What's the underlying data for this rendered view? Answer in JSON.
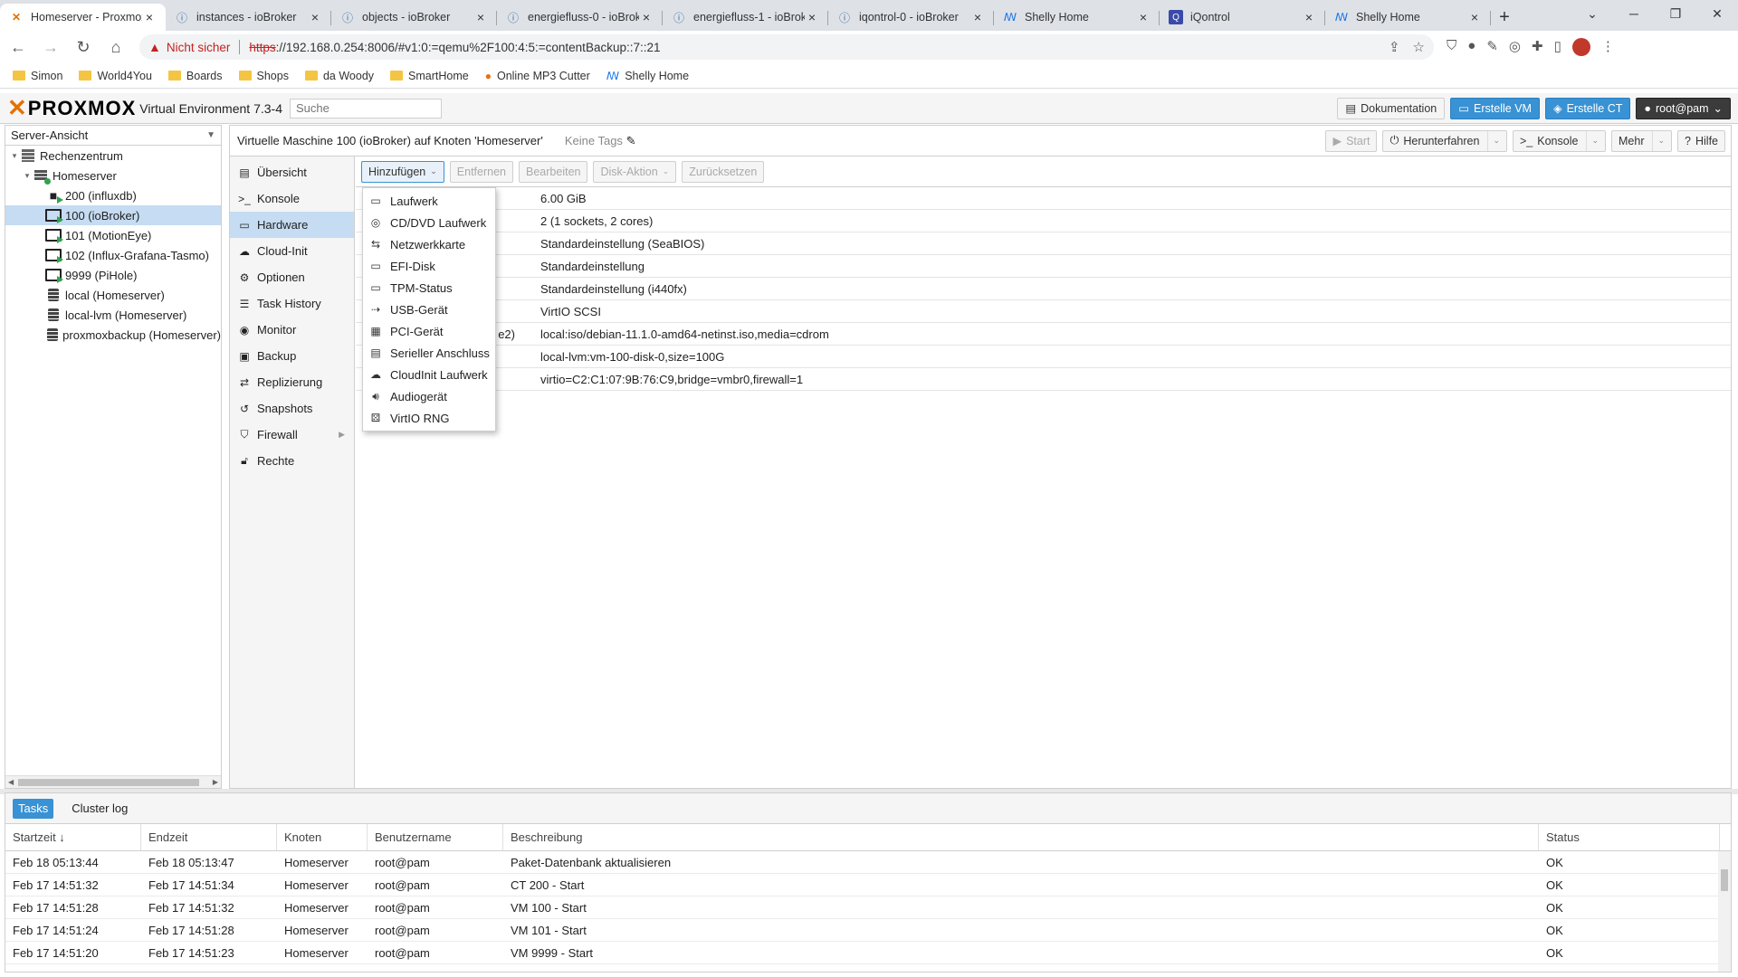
{
  "browser": {
    "tabs": [
      {
        "title": "Homeserver - Proxmox",
        "active": true,
        "icon": "proxmox-icon"
      },
      {
        "title": "instances - ioBroker",
        "icon": "iobroker-icon"
      },
      {
        "title": "objects - ioBroker",
        "icon": "iobroker-icon"
      },
      {
        "title": "energiefluss-0 - ioBroker",
        "icon": "iobroker-icon"
      },
      {
        "title": "energiefluss-1 - ioBroker",
        "icon": "iobroker-icon"
      },
      {
        "title": "iqontrol-0 - ioBroker",
        "icon": "iobroker-icon"
      },
      {
        "title": "Shelly Home",
        "icon": "shelly-icon"
      },
      {
        "title": "iQontrol",
        "icon": "iqontrol-icon"
      },
      {
        "title": "Shelly Home",
        "icon": "shelly-icon"
      }
    ],
    "address": {
      "security_label": "Nicht sicher",
      "scheme": "https",
      "rest": "://192.168.0.254:8006/#v1:0:=qemu%2F100:4:5:=contentBackup::7::21"
    },
    "bookmarks": [
      {
        "label": "Simon",
        "type": "folder"
      },
      {
        "label": "World4You",
        "type": "folder"
      },
      {
        "label": "Boards",
        "type": "folder"
      },
      {
        "label": "Shops",
        "type": "folder"
      },
      {
        "label": "da Woody",
        "type": "folder"
      },
      {
        "label": "SmartHome",
        "type": "folder"
      },
      {
        "label": "Online MP3 Cutter",
        "type": "link"
      },
      {
        "label": "Shelly Home",
        "type": "link"
      }
    ]
  },
  "header": {
    "logo_text": "PROXMOX",
    "version": "Virtual Environment 7.3-4",
    "search_placeholder": "Suche",
    "buttons": {
      "docs": "Dokumentation",
      "create_vm": "Erstelle VM",
      "create_ct": "Erstelle CT",
      "user": "root@pam"
    }
  },
  "tree": {
    "view": "Server-Ansicht",
    "items": [
      {
        "label": "Rechenzentrum",
        "depth": 0,
        "icon": "datacenter-icon",
        "exp": "▾"
      },
      {
        "label": "Homeserver",
        "depth": 1,
        "icon": "server-icon",
        "exp": "▾"
      },
      {
        "label": "200 (influxdb)",
        "depth": 2,
        "icon": "container-icon"
      },
      {
        "label": "100 (ioBroker)",
        "depth": 2,
        "icon": "vm-running-icon",
        "selected": true
      },
      {
        "label": "101 (MotionEye)",
        "depth": 2,
        "icon": "vm-running-icon"
      },
      {
        "label": "102 (Influx-Grafana-Tasmo)",
        "depth": 2,
        "icon": "vm-running-icon"
      },
      {
        "label": "9999 (PiHole)",
        "depth": 2,
        "icon": "vm-running-icon"
      },
      {
        "label": "local (Homeserver)",
        "depth": 2,
        "icon": "storage-icon"
      },
      {
        "label": "local-lvm (Homeserver)",
        "depth": 2,
        "icon": "storage-icon"
      },
      {
        "label": "proxmoxbackup (Homeserver)",
        "depth": 2,
        "icon": "storage-icon"
      }
    ]
  },
  "content": {
    "title": "Virtuelle Maschine 100 (ioBroker) auf Knoten 'Homeserver'",
    "tags": "Keine Tags",
    "actions": {
      "start": "Start",
      "shutdown": "Herunterfahren",
      "console": "Konsole",
      "more": "Mehr",
      "help": "Hilfe"
    }
  },
  "vm_menu": [
    {
      "label": "Übersicht",
      "icon": "book-icon"
    },
    {
      "label": "Konsole",
      "icon": "terminal-icon"
    },
    {
      "label": "Hardware",
      "icon": "monitor-icon",
      "selected": true
    },
    {
      "label": "Cloud-Init",
      "icon": "cloud-icon"
    },
    {
      "label": "Optionen",
      "icon": "gear-icon"
    },
    {
      "label": "Task History",
      "icon": "list-icon"
    },
    {
      "label": "Monitor",
      "icon": "eye-icon"
    },
    {
      "label": "Backup",
      "icon": "floppy-icon"
    },
    {
      "label": "Replizierung",
      "icon": "retweet-icon"
    },
    {
      "label": "Snapshots",
      "icon": "history-icon"
    },
    {
      "label": "Firewall",
      "icon": "shield-icon",
      "has_arrow": true
    },
    {
      "label": "Rechte",
      "icon": "unlock-icon"
    }
  ],
  "hw_toolbar": {
    "add": "Hinzufügen",
    "remove": "Entfernen",
    "edit": "Bearbeiten",
    "disk_action": "Disk-Aktion",
    "revert": "Zurücksetzen"
  },
  "hardware": [
    {
      "key": "",
      "value": "6.00 GiB"
    },
    {
      "key": "",
      "value": "2 (1 sockets, 2 cores)"
    },
    {
      "key": "",
      "value": "Standardeinstellung (SeaBIOS)"
    },
    {
      "key": "",
      "value": "Standardeinstellung"
    },
    {
      "key": "",
      "value": "Standardeinstellung (i440fx)"
    },
    {
      "key": "",
      "value": "VirtIO SCSI"
    },
    {
      "key": "e2)",
      "value": "local:iso/debian-11.1.0-amd64-netinst.iso,media=cdrom"
    },
    {
      "key": "",
      "value": "local-lvm:vm-100-disk-0,size=100G"
    },
    {
      "key": "",
      "value": "virtio=C2:C1:07:9B:76:C9,bridge=vmbr0,firewall=1"
    }
  ],
  "add_menu": [
    {
      "label": "Laufwerk",
      "icon": "hdd-icon"
    },
    {
      "label": "CD/DVD Laufwerk",
      "icon": "cdrom-icon"
    },
    {
      "label": "Netzwerkkarte",
      "icon": "exchange-icon"
    },
    {
      "label": "EFI-Disk",
      "icon": "hdd-icon"
    },
    {
      "label": "TPM-Status",
      "icon": "hdd-icon"
    },
    {
      "label": "USB-Gerät",
      "icon": "usb-icon"
    },
    {
      "label": "PCI-Gerät",
      "icon": "pci-card-icon"
    },
    {
      "label": "Serieller Anschluss",
      "icon": "serial-port-icon"
    },
    {
      "label": "CloudInit Laufwerk",
      "icon": "cloud-icon"
    },
    {
      "label": "Audiogerät",
      "icon": "volume-icon"
    },
    {
      "label": "VirtIO RNG",
      "icon": "dice-icon"
    }
  ],
  "tasks": {
    "tabs": [
      "Tasks",
      "Cluster log"
    ],
    "columns": [
      "Startzeit ↓",
      "Endzeit",
      "Knoten",
      "Benutzername",
      "Beschreibung",
      "Status"
    ],
    "rows": [
      [
        "Feb 18 05:13:44",
        "Feb 18 05:13:47",
        "Homeserver",
        "root@pam",
        "Paket-Datenbank aktualisieren",
        "OK"
      ],
      [
        "Feb 17 14:51:32",
        "Feb 17 14:51:34",
        "Homeserver",
        "root@pam",
        "CT 200 - Start",
        "OK"
      ],
      [
        "Feb 17 14:51:28",
        "Feb 17 14:51:32",
        "Homeserver",
        "root@pam",
        "VM 100 - Start",
        "OK"
      ],
      [
        "Feb 17 14:51:24",
        "Feb 17 14:51:28",
        "Homeserver",
        "root@pam",
        "VM 101 - Start",
        "OK"
      ],
      [
        "Feb 17 14:51:20",
        "Feb 17 14:51:23",
        "Homeserver",
        "root@pam",
        "VM 9999 - Start",
        "OK"
      ]
    ]
  }
}
